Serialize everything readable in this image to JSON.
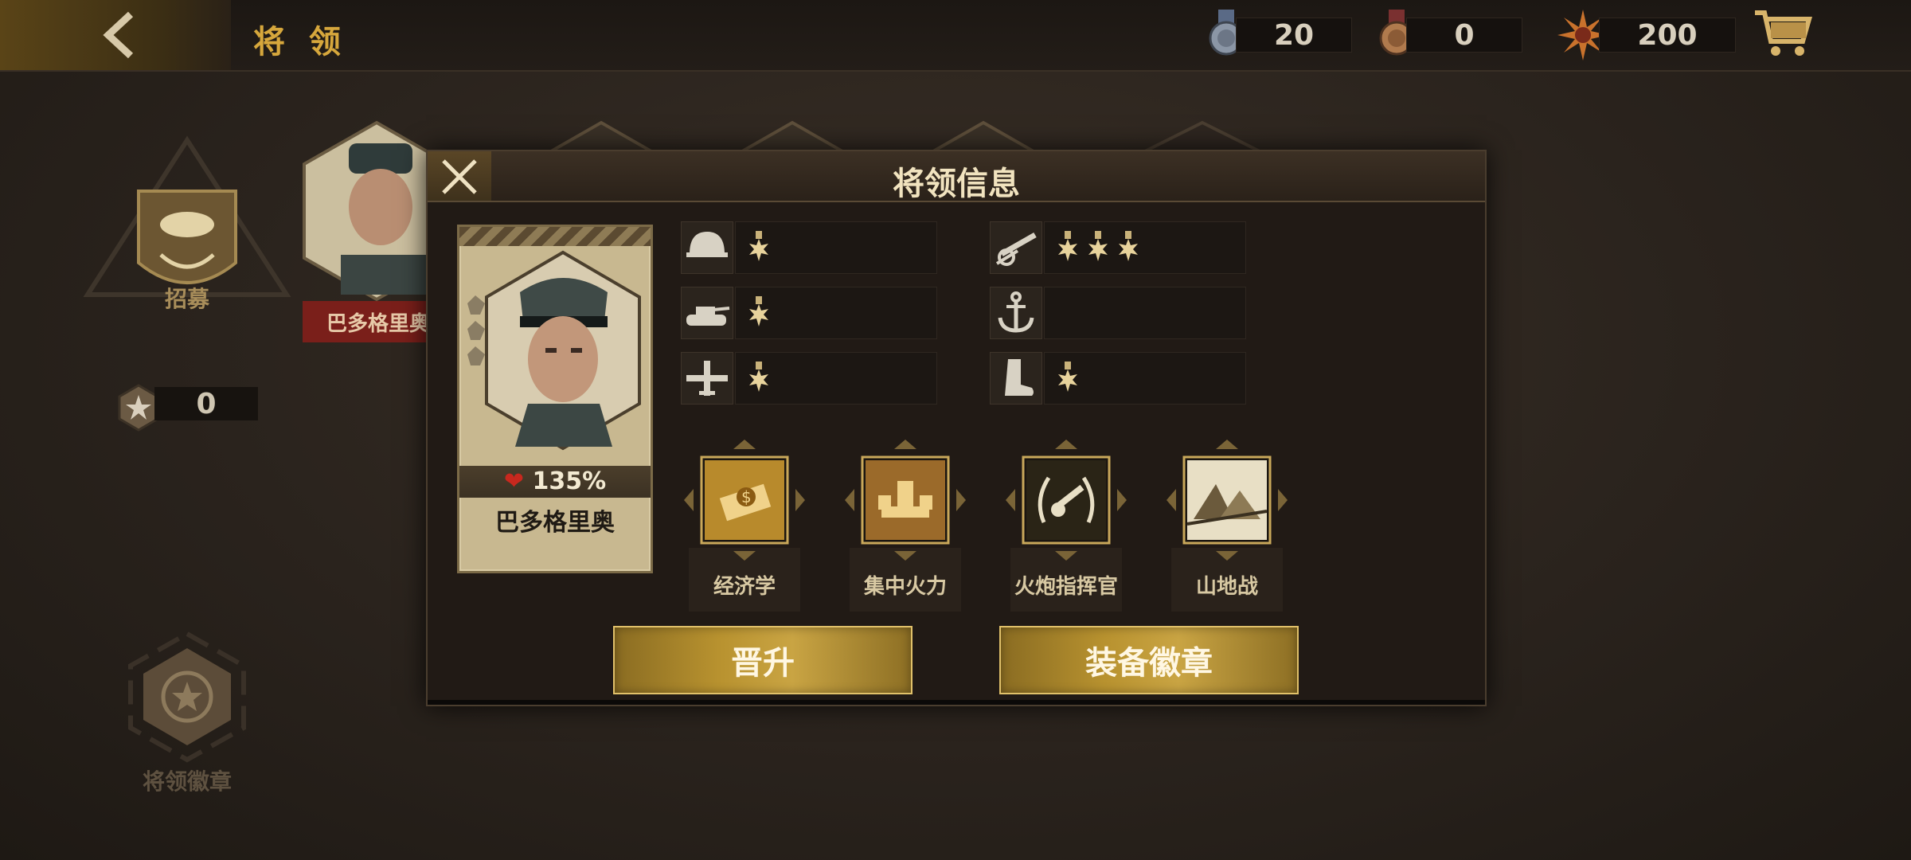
{
  "header": {
    "title": "将 领"
  },
  "currencies": [
    {
      "icon": "silver-medal-icon",
      "value": "20"
    },
    {
      "icon": "bronze-medal-icon",
      "value": "0"
    },
    {
      "icon": "sun-badge-icon",
      "value": "200"
    }
  ],
  "sidebar": {
    "recruit_label": "招募",
    "badge_count": "0",
    "general_badge_label": "将领徽章"
  },
  "background": {
    "selected_general_name": "巴多格里奥"
  },
  "modal": {
    "title": "将领信息",
    "general": {
      "name": "巴多格里奥",
      "stat": "135%",
      "stars": 3
    },
    "attributes": [
      {
        "icon": "helmet-icon",
        "level": 1
      },
      {
        "icon": "artillery-icon",
        "level": 3
      },
      {
        "icon": "tank-icon",
        "level": 1
      },
      {
        "icon": "anchor-icon",
        "level": 0
      },
      {
        "icon": "plane-icon",
        "level": 1
      },
      {
        "icon": "boot-icon",
        "level": 1
      }
    ],
    "skills": [
      {
        "icon": "economy-icon",
        "name": "经济学"
      },
      {
        "icon": "concentrated-fire-icon",
        "name": "集中火力"
      },
      {
        "icon": "artillery-commander-icon",
        "name": "火炮指挥官"
      },
      {
        "icon": "mountain-icon",
        "name": "山地战"
      }
    ],
    "promote_label": "晋升",
    "equip_badge_label": "装备徽章"
  },
  "colors": {
    "accent": "#d6a73c",
    "button_gold": "#b8922f",
    "heart": "#c8281e"
  }
}
